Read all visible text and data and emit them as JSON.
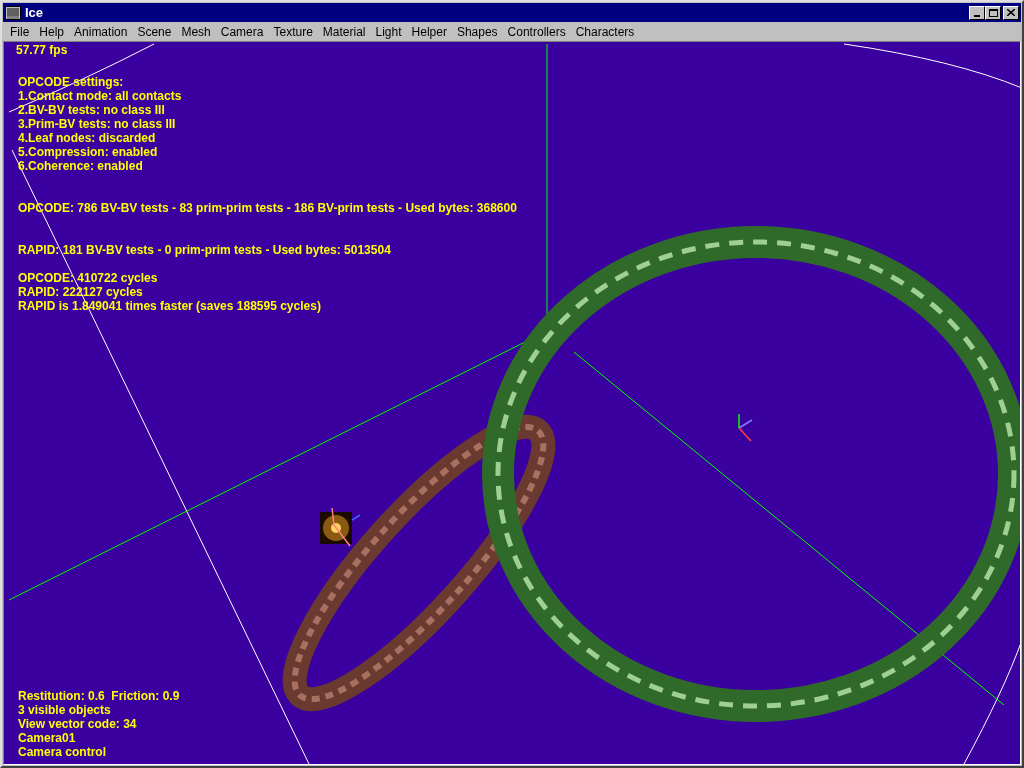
{
  "window": {
    "title": "Ice"
  },
  "menu": [
    "File",
    "Help",
    "Animation",
    "Scene",
    "Mesh",
    "Camera",
    "Texture",
    "Material",
    "Light",
    "Helper",
    "Shapes",
    "Controllers",
    "Characters"
  ],
  "viewport": {
    "fps": "57.77 fps",
    "settings": [
      "OPCODE settings:",
      "1.Contact mode: all contacts",
      "2.BV-BV tests: no class III",
      "3.Prim-BV tests: no class III",
      "4.Leaf nodes: discarded",
      "5.Compression: enabled",
      "6.Coherence: enabled"
    ],
    "opcode_stats": "OPCODE: 786 BV-BV tests - 83 prim-prim tests - 186 BV-prim tests - Used bytes: 368600",
    "rapid_stats": "RAPID: 181 BV-BV tests - 0 prim-prim tests - Used bytes: 5013504",
    "timing": [
      "OPCODE: 410722 cycles",
      "RAPID: 222127 cycles",
      "RAPID is 1.849041 times faster (saves 188595 cycles)"
    ],
    "status": [
      "Restitution: 0.6  Friction: 0.9",
      "3 visible objects",
      "View vector code: 34",
      "Camera01",
      "Camera control"
    ]
  }
}
